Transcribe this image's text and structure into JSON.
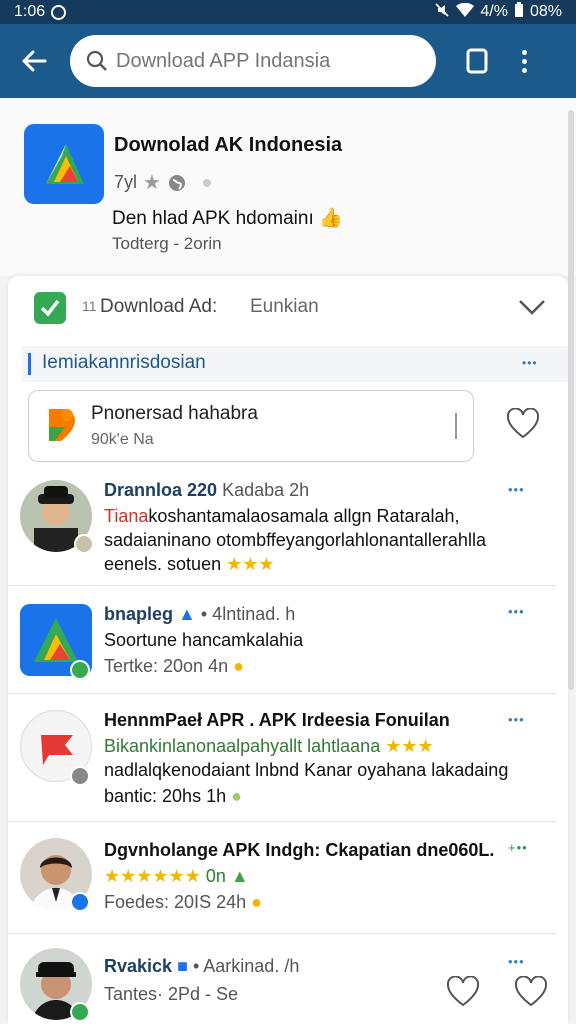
{
  "status_bar": {
    "time": "1:06",
    "battery": "08%",
    "signal": "4/%"
  },
  "search": {
    "placeholder": "Download APP Indansia"
  },
  "app": {
    "title": "Downolad AK Indonesia",
    "meta": "7yl",
    "tagline": "Den hlad APK hdomainı",
    "date": "Todterg - 2orin",
    "brand_color": "#1a73e8"
  },
  "download_row": {
    "num": "11",
    "label": "Download Ad:",
    "extra": "Eunkian"
  },
  "section": {
    "title": "Iemiakannrisdosian",
    "dots": "•••"
  },
  "featured": {
    "title": "Pnonersad hahabra",
    "sub": "90k'e Na"
  },
  "comments": [
    {
      "name": "Drannloa 220",
      "time": "Kadaba 2h",
      "line1_red": "Tiana",
      "line1": "koshantamalaosamala allgn Rataralah,",
      "line2": "sadaianinano otombffeyangorlahlonantallerahlla",
      "line3": "eenels. sotuen",
      "emoji": "★★★",
      "dots": "•••"
    },
    {
      "name": "bnapleg",
      "time": "• 4lntinad. h",
      "line1": "Soortune hancamkalahia",
      "line2": "Tertke: 20on 4n",
      "dots": "•••"
    },
    {
      "name": "HennmPaeł APR . APK Irdeesia Fonuilan",
      "line1": "Bikankinlanonaalpahyallt lahtlaana",
      "line1_stars": "★★★",
      "line2": "nadlalqkenodaiant lnbnd Kanar oyahana lakadaing",
      "line3": "bantic: 20hs 1h",
      "dots": "•••"
    },
    {
      "name": "Dgvnholange APK Indgh: Ckapatian dne060L.",
      "stars": "★★★★★★",
      "line1_extra": "0n",
      "line2": "Foedes: 20IS 24h",
      "dots": "+••"
    },
    {
      "name": "Rvakick",
      "time": "• Aarkinad. /h",
      "line1": "Tantes· 2Pd - Se",
      "dots": "•••"
    }
  ]
}
